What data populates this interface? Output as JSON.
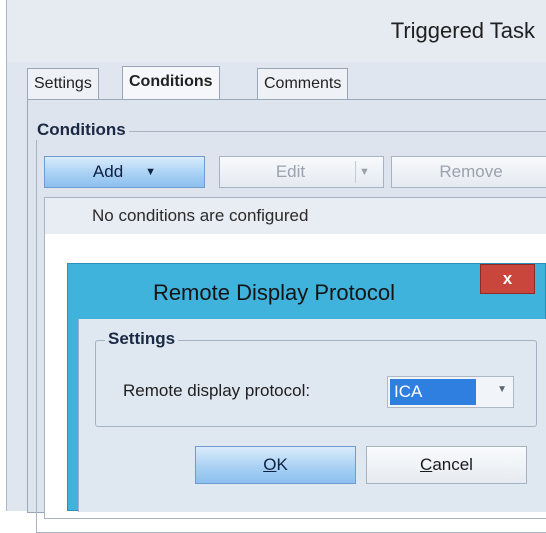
{
  "window": {
    "title": "Triggered Task"
  },
  "tabs": [
    {
      "label": "Settings",
      "active": false
    },
    {
      "label": "Conditions",
      "active": true
    },
    {
      "label": "Comments",
      "active": false
    }
  ],
  "conditions": {
    "group_title": "Conditions",
    "add_label": "Add",
    "edit_label": "Edit",
    "remove_label": "Remove",
    "empty_message": "No conditions are configured"
  },
  "dialog": {
    "title": "Remote Display Protocol",
    "close_glyph": "x",
    "settings_title": "Settings",
    "field_label": "Remote display protocol:",
    "field_value": "ICA",
    "ok_prefix": "",
    "ok_accel": "O",
    "ok_rest": "K",
    "cancel_accel": "C",
    "cancel_rest": "ancel"
  },
  "icons": {
    "dropdown": "chevron-down-icon",
    "close": "close-icon"
  },
  "colors": {
    "dialog_frame": "#40b3dc",
    "close_button": "#c9463d",
    "selection": "#2f7fe0"
  }
}
